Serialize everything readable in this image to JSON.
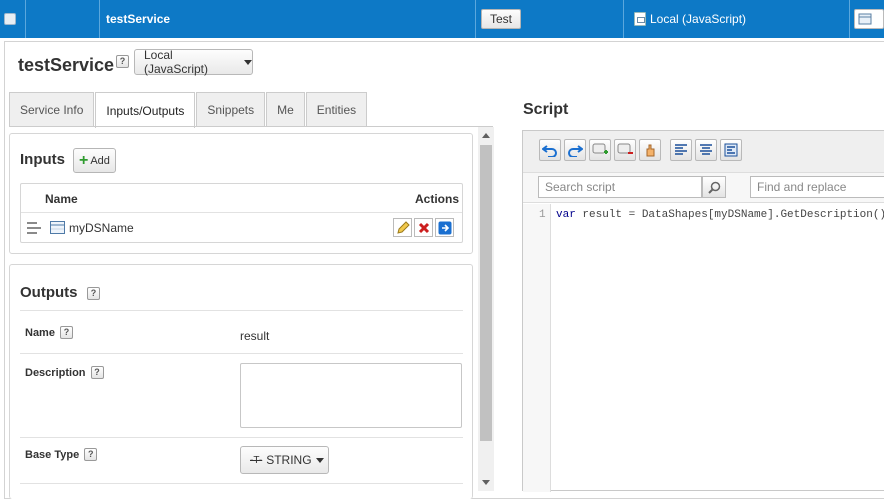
{
  "topbar": {
    "service_name": "testService",
    "test_button": "Test",
    "handler": "Local (JavaScript)"
  },
  "header": {
    "title": "testService",
    "help": "?",
    "handler_select": "Local (JavaScript)"
  },
  "tabs": [
    "Service Info",
    "Inputs/Outputs",
    "Snippets",
    "Me",
    "Entities"
  ],
  "inputs": {
    "heading": "Inputs",
    "add_label": "Add",
    "col_name": "Name",
    "col_actions": "Actions",
    "rows": [
      {
        "name": "myDSName"
      }
    ]
  },
  "outputs": {
    "heading": "Outputs",
    "help": "?",
    "name_label": "Name",
    "name_value": "result",
    "description_label": "Description",
    "description_value": "",
    "base_type_label": "Base Type",
    "base_type_value": "STRING"
  },
  "script": {
    "heading": "Script",
    "search_placeholder": "Search script",
    "replace_placeholder": "Find and replace",
    "line_number": "1",
    "code_var": "var",
    "code_rest": " result = DataShapes[myDSName].GetDescription();"
  },
  "colors": {
    "topbar": "#0d79c6",
    "accent_add": "#2e9b2e",
    "delete": "#cc1f1f",
    "goto": "#1a6fd0"
  }
}
